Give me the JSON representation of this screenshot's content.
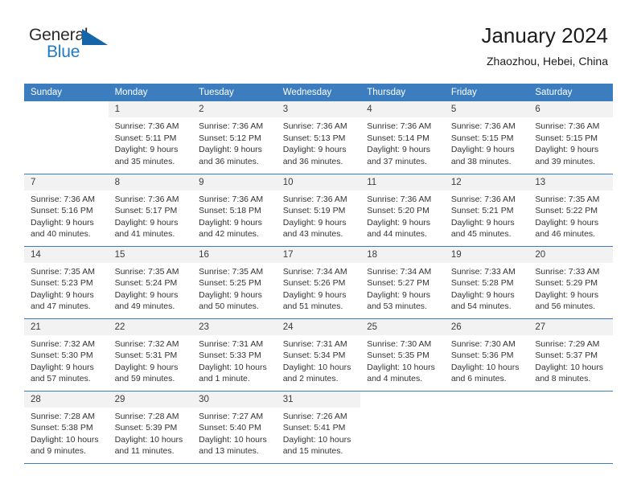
{
  "logo": {
    "text_top": "General",
    "text_bottom": "Blue",
    "triangle_color": "#1565a8",
    "blue_color": "#1f7ac4"
  },
  "header": {
    "title": "January 2024",
    "subtitle": "Zhaozhou, Hebei, China"
  },
  "theme": {
    "header_bar": "#3b7dbf",
    "daynum_strip": "#f2f2f2",
    "text": "#333333"
  },
  "weekdays": [
    "Sunday",
    "Monday",
    "Tuesday",
    "Wednesday",
    "Thursday",
    "Friday",
    "Saturday"
  ],
  "labels": {
    "sunrise_prefix": "Sunrise:",
    "sunset_prefix": "Sunset:",
    "daylight_prefix": "Daylight:"
  },
  "weeks": [
    [
      {
        "empty": true
      },
      {
        "day": "1",
        "sunrise": "Sunrise: 7:36 AM",
        "sunset": "Sunset: 5:11 PM",
        "daylight1": "Daylight: 9 hours",
        "daylight2": "and 35 minutes."
      },
      {
        "day": "2",
        "sunrise": "Sunrise: 7:36 AM",
        "sunset": "Sunset: 5:12 PM",
        "daylight1": "Daylight: 9 hours",
        "daylight2": "and 36 minutes."
      },
      {
        "day": "3",
        "sunrise": "Sunrise: 7:36 AM",
        "sunset": "Sunset: 5:13 PM",
        "daylight1": "Daylight: 9 hours",
        "daylight2": "and 36 minutes."
      },
      {
        "day": "4",
        "sunrise": "Sunrise: 7:36 AM",
        "sunset": "Sunset: 5:14 PM",
        "daylight1": "Daylight: 9 hours",
        "daylight2": "and 37 minutes."
      },
      {
        "day": "5",
        "sunrise": "Sunrise: 7:36 AM",
        "sunset": "Sunset: 5:15 PM",
        "daylight1": "Daylight: 9 hours",
        "daylight2": "and 38 minutes."
      },
      {
        "day": "6",
        "sunrise": "Sunrise: 7:36 AM",
        "sunset": "Sunset: 5:15 PM",
        "daylight1": "Daylight: 9 hours",
        "daylight2": "and 39 minutes."
      }
    ],
    [
      {
        "day": "7",
        "sunrise": "Sunrise: 7:36 AM",
        "sunset": "Sunset: 5:16 PM",
        "daylight1": "Daylight: 9 hours",
        "daylight2": "and 40 minutes."
      },
      {
        "day": "8",
        "sunrise": "Sunrise: 7:36 AM",
        "sunset": "Sunset: 5:17 PM",
        "daylight1": "Daylight: 9 hours",
        "daylight2": "and 41 minutes."
      },
      {
        "day": "9",
        "sunrise": "Sunrise: 7:36 AM",
        "sunset": "Sunset: 5:18 PM",
        "daylight1": "Daylight: 9 hours",
        "daylight2": "and 42 minutes."
      },
      {
        "day": "10",
        "sunrise": "Sunrise: 7:36 AM",
        "sunset": "Sunset: 5:19 PM",
        "daylight1": "Daylight: 9 hours",
        "daylight2": "and 43 minutes."
      },
      {
        "day": "11",
        "sunrise": "Sunrise: 7:36 AM",
        "sunset": "Sunset: 5:20 PM",
        "daylight1": "Daylight: 9 hours",
        "daylight2": "and 44 minutes."
      },
      {
        "day": "12",
        "sunrise": "Sunrise: 7:36 AM",
        "sunset": "Sunset: 5:21 PM",
        "daylight1": "Daylight: 9 hours",
        "daylight2": "and 45 minutes."
      },
      {
        "day": "13",
        "sunrise": "Sunrise: 7:35 AM",
        "sunset": "Sunset: 5:22 PM",
        "daylight1": "Daylight: 9 hours",
        "daylight2": "and 46 minutes."
      }
    ],
    [
      {
        "day": "14",
        "sunrise": "Sunrise: 7:35 AM",
        "sunset": "Sunset: 5:23 PM",
        "daylight1": "Daylight: 9 hours",
        "daylight2": "and 47 minutes."
      },
      {
        "day": "15",
        "sunrise": "Sunrise: 7:35 AM",
        "sunset": "Sunset: 5:24 PM",
        "daylight1": "Daylight: 9 hours",
        "daylight2": "and 49 minutes."
      },
      {
        "day": "16",
        "sunrise": "Sunrise: 7:35 AM",
        "sunset": "Sunset: 5:25 PM",
        "daylight1": "Daylight: 9 hours",
        "daylight2": "and 50 minutes."
      },
      {
        "day": "17",
        "sunrise": "Sunrise: 7:34 AM",
        "sunset": "Sunset: 5:26 PM",
        "daylight1": "Daylight: 9 hours",
        "daylight2": "and 51 minutes."
      },
      {
        "day": "18",
        "sunrise": "Sunrise: 7:34 AM",
        "sunset": "Sunset: 5:27 PM",
        "daylight1": "Daylight: 9 hours",
        "daylight2": "and 53 minutes."
      },
      {
        "day": "19",
        "sunrise": "Sunrise: 7:33 AM",
        "sunset": "Sunset: 5:28 PM",
        "daylight1": "Daylight: 9 hours",
        "daylight2": "and 54 minutes."
      },
      {
        "day": "20",
        "sunrise": "Sunrise: 7:33 AM",
        "sunset": "Sunset: 5:29 PM",
        "daylight1": "Daylight: 9 hours",
        "daylight2": "and 56 minutes."
      }
    ],
    [
      {
        "day": "21",
        "sunrise": "Sunrise: 7:32 AM",
        "sunset": "Sunset: 5:30 PM",
        "daylight1": "Daylight: 9 hours",
        "daylight2": "and 57 minutes."
      },
      {
        "day": "22",
        "sunrise": "Sunrise: 7:32 AM",
        "sunset": "Sunset: 5:31 PM",
        "daylight1": "Daylight: 9 hours",
        "daylight2": "and 59 minutes."
      },
      {
        "day": "23",
        "sunrise": "Sunrise: 7:31 AM",
        "sunset": "Sunset: 5:33 PM",
        "daylight1": "Daylight: 10 hours",
        "daylight2": "and 1 minute."
      },
      {
        "day": "24",
        "sunrise": "Sunrise: 7:31 AM",
        "sunset": "Sunset: 5:34 PM",
        "daylight1": "Daylight: 10 hours",
        "daylight2": "and 2 minutes."
      },
      {
        "day": "25",
        "sunrise": "Sunrise: 7:30 AM",
        "sunset": "Sunset: 5:35 PM",
        "daylight1": "Daylight: 10 hours",
        "daylight2": "and 4 minutes."
      },
      {
        "day": "26",
        "sunrise": "Sunrise: 7:30 AM",
        "sunset": "Sunset: 5:36 PM",
        "daylight1": "Daylight: 10 hours",
        "daylight2": "and 6 minutes."
      },
      {
        "day": "27",
        "sunrise": "Sunrise: 7:29 AM",
        "sunset": "Sunset: 5:37 PM",
        "daylight1": "Daylight: 10 hours",
        "daylight2": "and 8 minutes."
      }
    ],
    [
      {
        "day": "28",
        "sunrise": "Sunrise: 7:28 AM",
        "sunset": "Sunset: 5:38 PM",
        "daylight1": "Daylight: 10 hours",
        "daylight2": "and 9 minutes."
      },
      {
        "day": "29",
        "sunrise": "Sunrise: 7:28 AM",
        "sunset": "Sunset: 5:39 PM",
        "daylight1": "Daylight: 10 hours",
        "daylight2": "and 11 minutes."
      },
      {
        "day": "30",
        "sunrise": "Sunrise: 7:27 AM",
        "sunset": "Sunset: 5:40 PM",
        "daylight1": "Daylight: 10 hours",
        "daylight2": "and 13 minutes."
      },
      {
        "day": "31",
        "sunrise": "Sunrise: 7:26 AM",
        "sunset": "Sunset: 5:41 PM",
        "daylight1": "Daylight: 10 hours",
        "daylight2": "and 15 minutes."
      },
      {
        "empty": true
      },
      {
        "empty": true
      },
      {
        "empty": true
      }
    ]
  ]
}
